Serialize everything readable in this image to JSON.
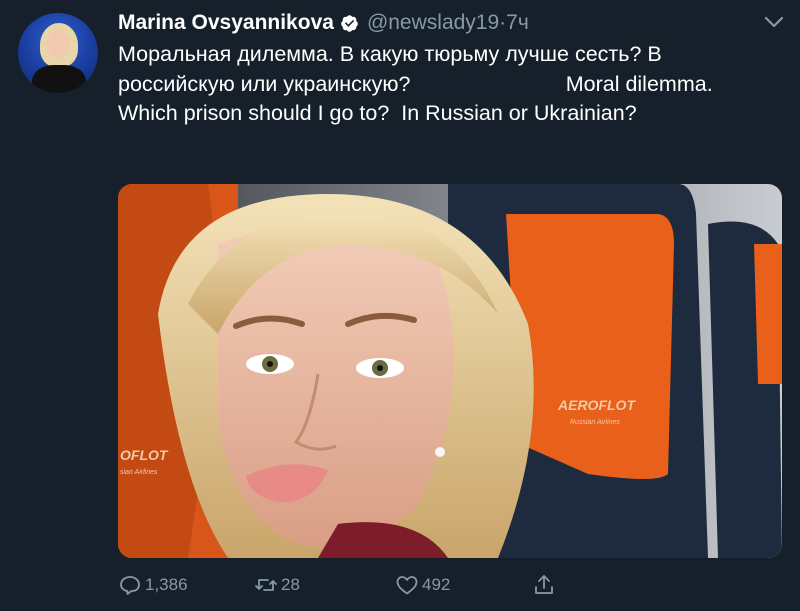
{
  "tweet": {
    "author_name": "Marina Ovsyannikova",
    "handle": "@newslady19",
    "separator": "·",
    "time": "7ч",
    "text": "Моральная дилемма. В какую тюрьму лучше сесть? В российскую или украинскую?                          Moral dilemma.  Which prison should I go to?  In Russian or Ukrainian?",
    "media_logo_right": "AEROFLOT",
    "media_logo_right_sub": "Russian Airlines",
    "media_logo_left": "OFLOT",
    "media_logo_left_sub": "sian Airlines"
  },
  "actions": {
    "reply_count": "1,386",
    "retweet_count": "28",
    "like_count": "492"
  },
  "icons": {
    "verified": "verified-badge-icon",
    "more": "chevron-down-icon",
    "reply": "reply-icon",
    "retweet": "retweet-icon",
    "like": "heart-icon",
    "share": "share-icon"
  },
  "colors": {
    "background": "#15202b",
    "secondary_text": "#8899a6",
    "seat_orange": "#e8601a"
  }
}
